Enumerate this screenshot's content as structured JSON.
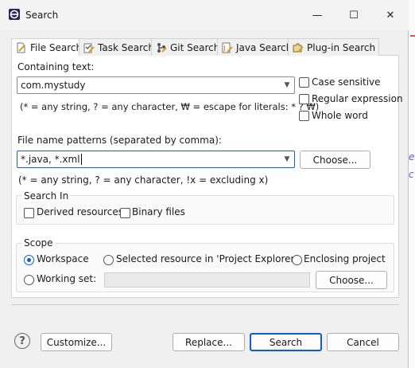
{
  "window": {
    "title": "Search",
    "controls": {
      "minimize": "—",
      "maximize": "☐",
      "close": "✕"
    },
    "side_marks": [
      "eL",
      "c"
    ]
  },
  "tabs": [
    {
      "label": "File Search",
      "icon": "file-search-icon",
      "active": true
    },
    {
      "label": "Task Search",
      "icon": "task-search-icon"
    },
    {
      "label": "Git Search",
      "icon": "git-search-icon"
    },
    {
      "label": "Java Search",
      "icon": "java-search-icon"
    },
    {
      "label": "Plug-in Search",
      "icon": "plugin-search-icon"
    }
  ],
  "containing_text": {
    "label": "Containing text:",
    "value": "com.mystudy",
    "hint": "(* = any string, ? = any character, ₩ = escape for literals: * ? ₩)"
  },
  "options": {
    "case_sensitive": "Case sensitive",
    "regular_expression": "Regular expression",
    "whole_word": "Whole word"
  },
  "file_patterns": {
    "label": "File name patterns (separated by comma):",
    "value": "*.java, *.xml",
    "choose": "Choose...",
    "hint": "(* = any string, ? = any character, !x = excluding x)"
  },
  "search_in": {
    "title": "Search In",
    "derived": "Derived resources",
    "binary": "Binary files"
  },
  "scope": {
    "title": "Scope",
    "workspace": "Workspace",
    "selected": "Selected resource in 'Project Explorer'",
    "enclosing": "Enclosing project",
    "working_set": "Working set:",
    "choose": "Choose...",
    "selected_option": "Workspace"
  },
  "buttons": {
    "customize": "Customize...",
    "replace": "Replace...",
    "search": "Search",
    "cancel": "Cancel"
  },
  "colors": {
    "accent": "#0b5ed7",
    "side_text": "#5b5bd6"
  }
}
